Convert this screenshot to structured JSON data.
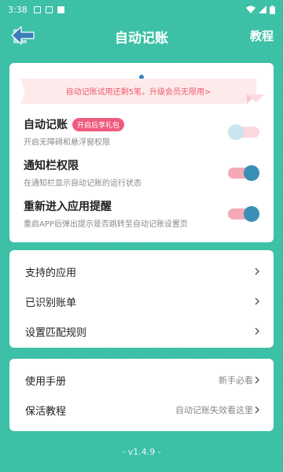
{
  "status_bar": {
    "time": "3:38",
    "icons": [
      "notification-square-icon",
      "notification-square-icon",
      "download-square-icon",
      "wifi-icon",
      "signal-icon",
      "battery-icon"
    ]
  },
  "header": {
    "title": "自动记账",
    "right_action": "教程",
    "back_icon": "back-arrow-icon"
  },
  "banner": {
    "text": "自动记账试用还剩5笔，升级会员无限用>"
  },
  "settings": [
    {
      "title": "自动记账",
      "badge": "开启后享礼包",
      "description": "开启无障碍和悬浮窗权限",
      "enabled": false
    },
    {
      "title": "通知栏权限",
      "description": "在通知栏显示自动记账的运行状态",
      "enabled": true
    },
    {
      "title": "重新进入应用提醒",
      "description": "重启APP后弹出提示是否跳转至自动记账设置页",
      "enabled": true
    }
  ],
  "menu_group_1": [
    {
      "label": "支持的应用"
    },
    {
      "label": "已识别账单"
    },
    {
      "label": "设置匹配规则"
    }
  ],
  "menu_group_2": [
    {
      "label": "使用手册",
      "value": "新手必看"
    },
    {
      "label": "保活教程",
      "value": "自动记账失效看这里"
    }
  ],
  "footer": {
    "version": "- v1.4.9 -"
  },
  "colors": {
    "background": "#3cc0a6",
    "banner_text": "#ef5b6b",
    "badge": "#ef5b7e",
    "toggle_on_knob": "#3a8fb4",
    "toggle_on_track": "#f5a9b8",
    "toggle_off_knob": "#c8e6f0",
    "toggle_off_track": "#fcd7dc"
  }
}
